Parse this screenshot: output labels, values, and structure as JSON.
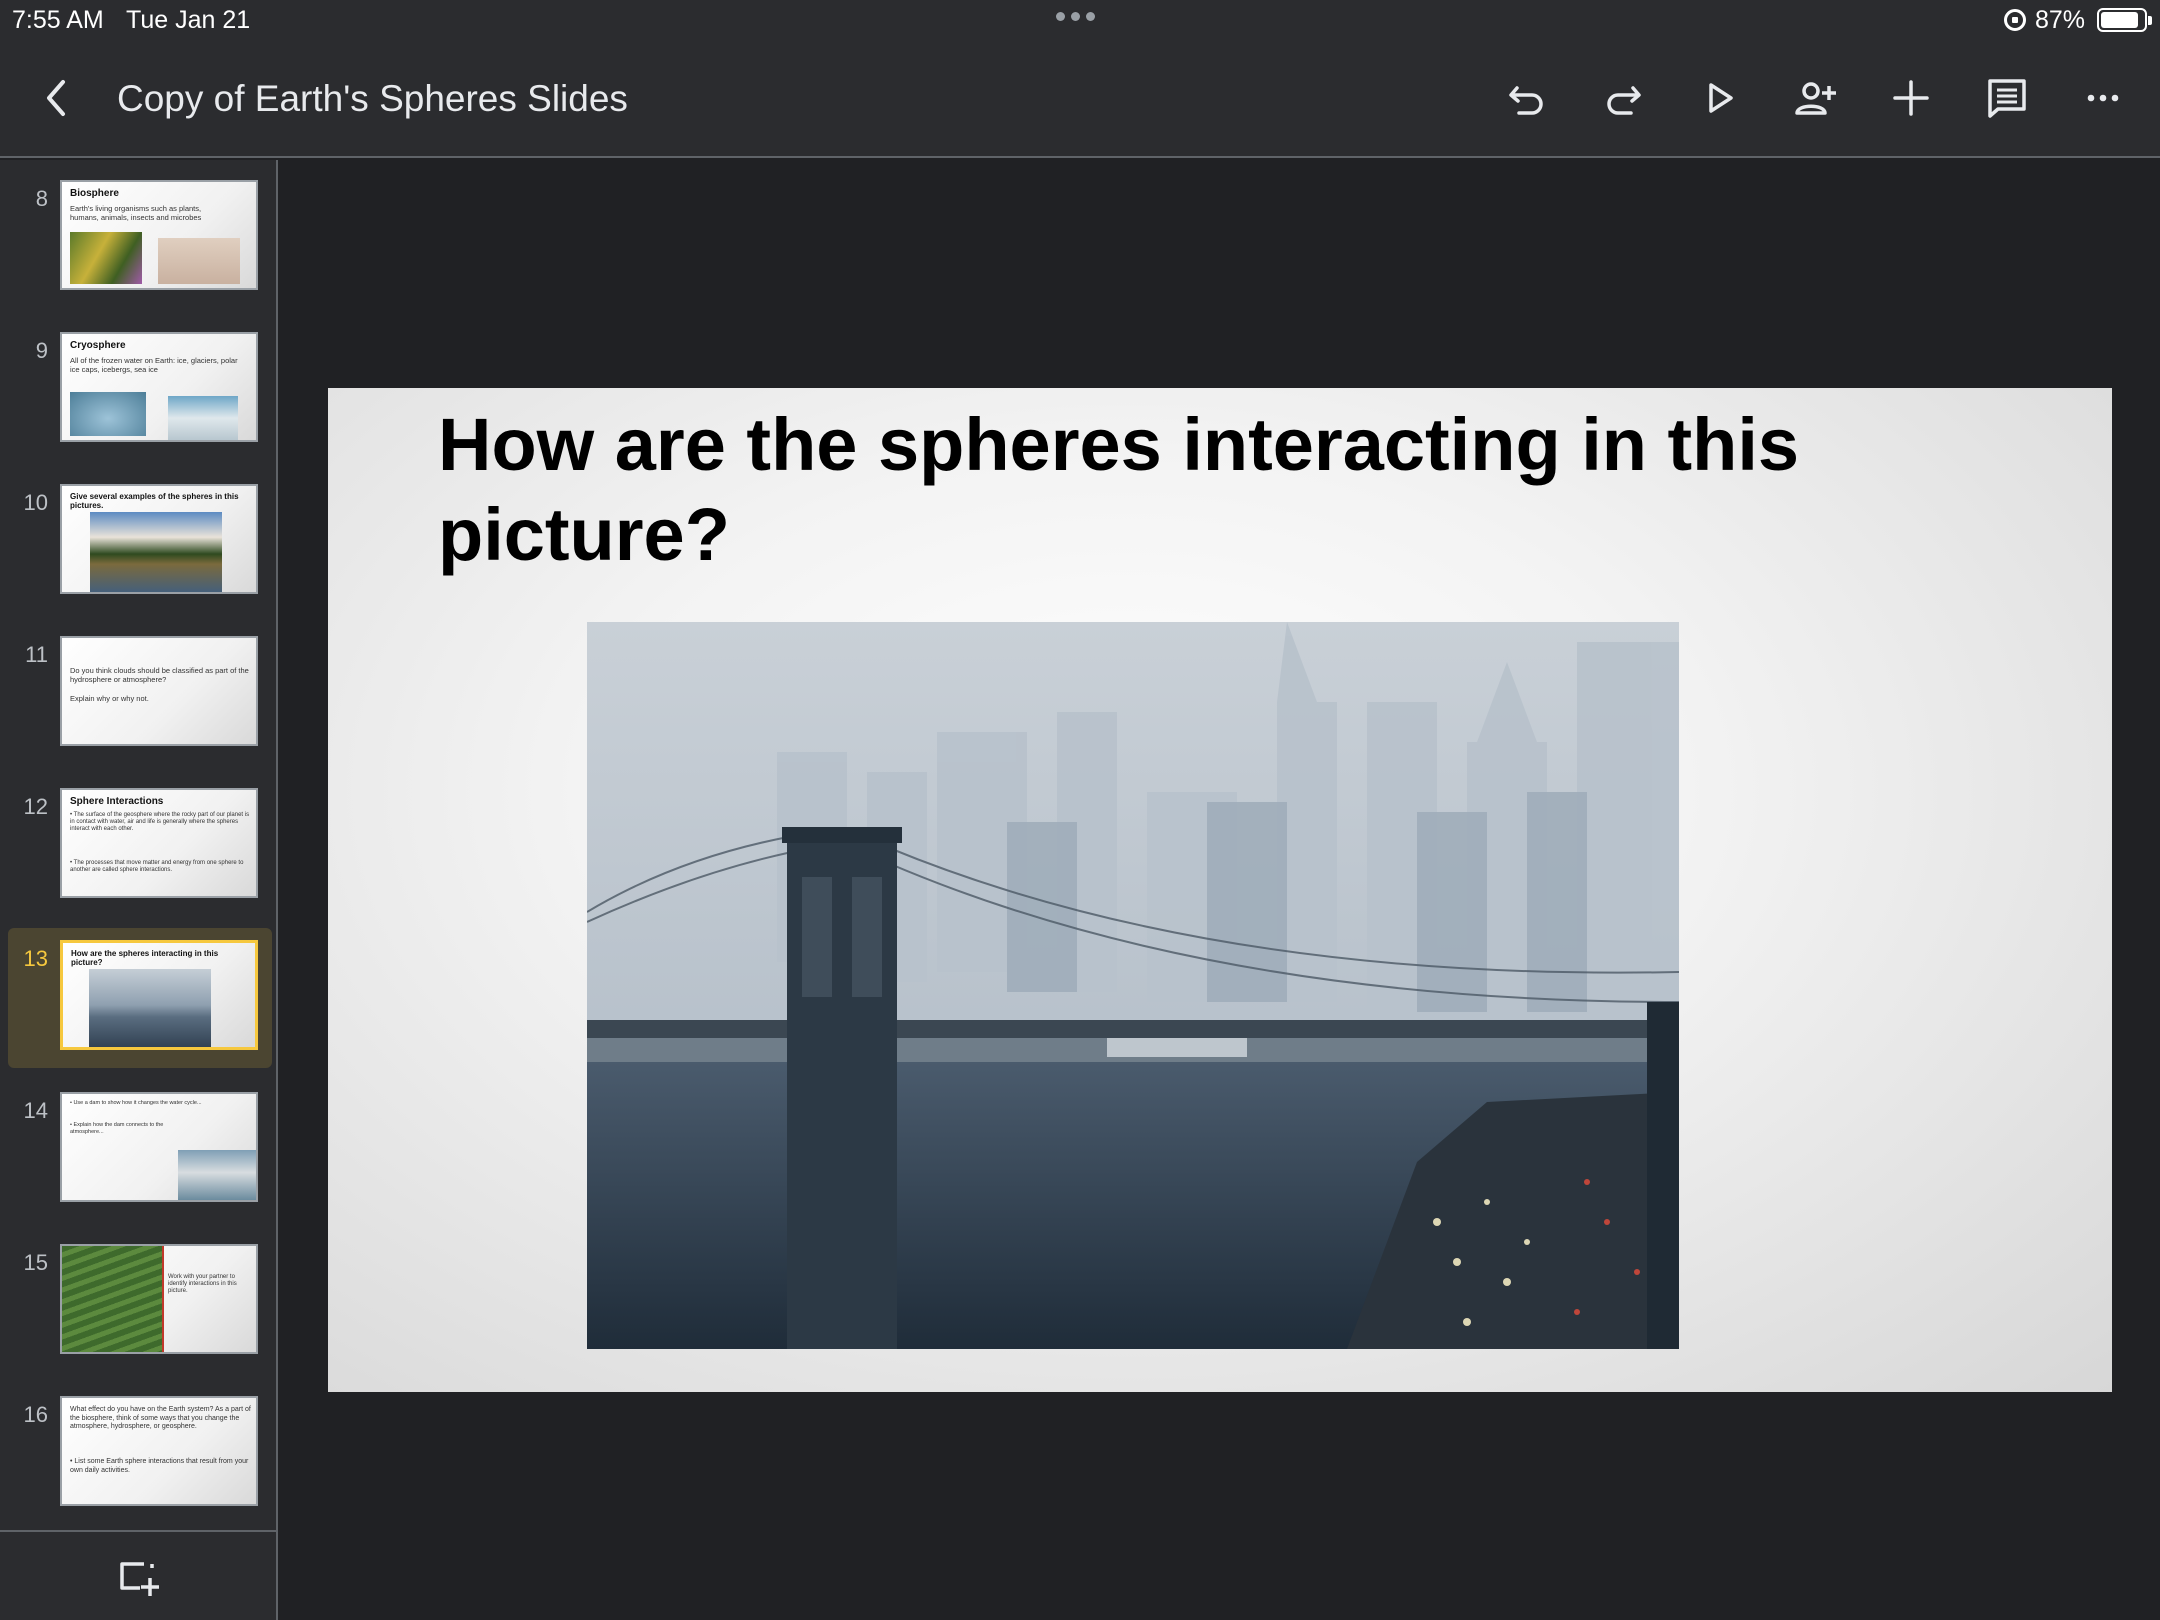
{
  "status_bar": {
    "time": "7:55 AM",
    "date": "Tue Jan 21",
    "battery_percent": "87%",
    "battery_level": 0.87
  },
  "toolbar": {
    "title": "Copy of Earth's Spheres Slides",
    "icons": [
      "back-icon",
      "undo-icon",
      "redo-icon",
      "present-icon",
      "add-person-icon",
      "plus-icon",
      "comment-icon",
      "more-icon"
    ]
  },
  "slides": [
    {
      "number": "8",
      "title": "Biosphere",
      "text": "Earth's living organisms such as plants, humans, animals, insects and microbes"
    },
    {
      "number": "9",
      "title": "Cryosphere",
      "text": "All of the frozen water on Earth: ice, glaciers, polar ice caps, icebergs, sea ice"
    },
    {
      "number": "10",
      "title": "Give several examples of the spheres in this pictures.",
      "text": ""
    },
    {
      "number": "11",
      "title": "",
      "text": "Do you think clouds should be classified as part of the hydrosphere or atmosphere?",
      "text2": "Explain why or why not."
    },
    {
      "number": "12",
      "title": "Sphere Interactions",
      "text": "• The surface of the geosphere where the rocky part of our planet is in contact with water, air and life is generally where the spheres interact with each other.",
      "text2": "• The processes that move matter and energy from one sphere to another are called sphere interactions."
    },
    {
      "number": "13",
      "title": "How are the spheres interacting in this picture?",
      "text": ""
    },
    {
      "number": "14",
      "title": "",
      "text": "• Use a dam to show how it changes the water cycle...",
      "text2": "• Explain how the dam connects to the atmosphere..."
    },
    {
      "number": "15",
      "title": "",
      "text": "Work with your partner to identify interactions in this picture."
    },
    {
      "number": "16",
      "title": "",
      "text": "What effect do you have on the Earth system? As a part of the biosphere, think of some ways that you change the atmosphere, hydrosphere, or geosphere.",
      "text2": "• List some Earth sphere interactions that result from your own daily activities."
    }
  ],
  "selected_slide": "13",
  "current_slide": {
    "title": "How are the spheres interacting in this picture?"
  },
  "colors": {
    "background": "#202124",
    "chrome": "#2b2c2f",
    "selection_accent": "#f6c83e"
  }
}
